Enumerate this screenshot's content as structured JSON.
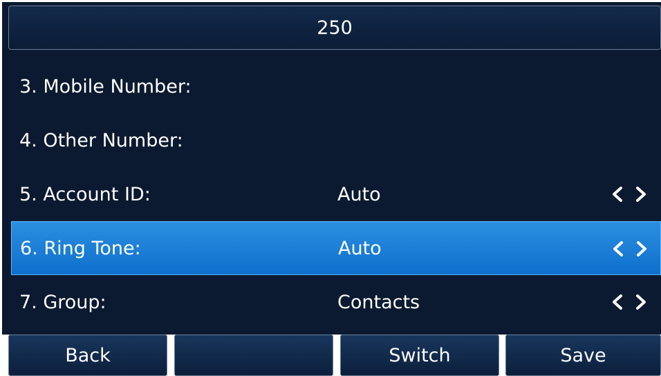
{
  "header": {
    "value": "250"
  },
  "rows": [
    {
      "label": "3. Mobile Number:",
      "value": ""
    },
    {
      "label": "4. Other Number:",
      "value": ""
    },
    {
      "label": "5. Account ID:",
      "value": "Auto"
    },
    {
      "label": "6. Ring Tone:",
      "value": "Auto"
    },
    {
      "label": "7. Group:",
      "value": "Contacts"
    }
  ],
  "selected_row": "6. Ring Tone:",
  "softkeys": [
    "Back",
    "",
    "Switch",
    "Save"
  ],
  "colors": {
    "background": "#0b1a30",
    "selection": "#1e80d8",
    "text": "#ffffff"
  },
  "icons": [
    "chevron-left-icon",
    "chevron-right-icon"
  ]
}
